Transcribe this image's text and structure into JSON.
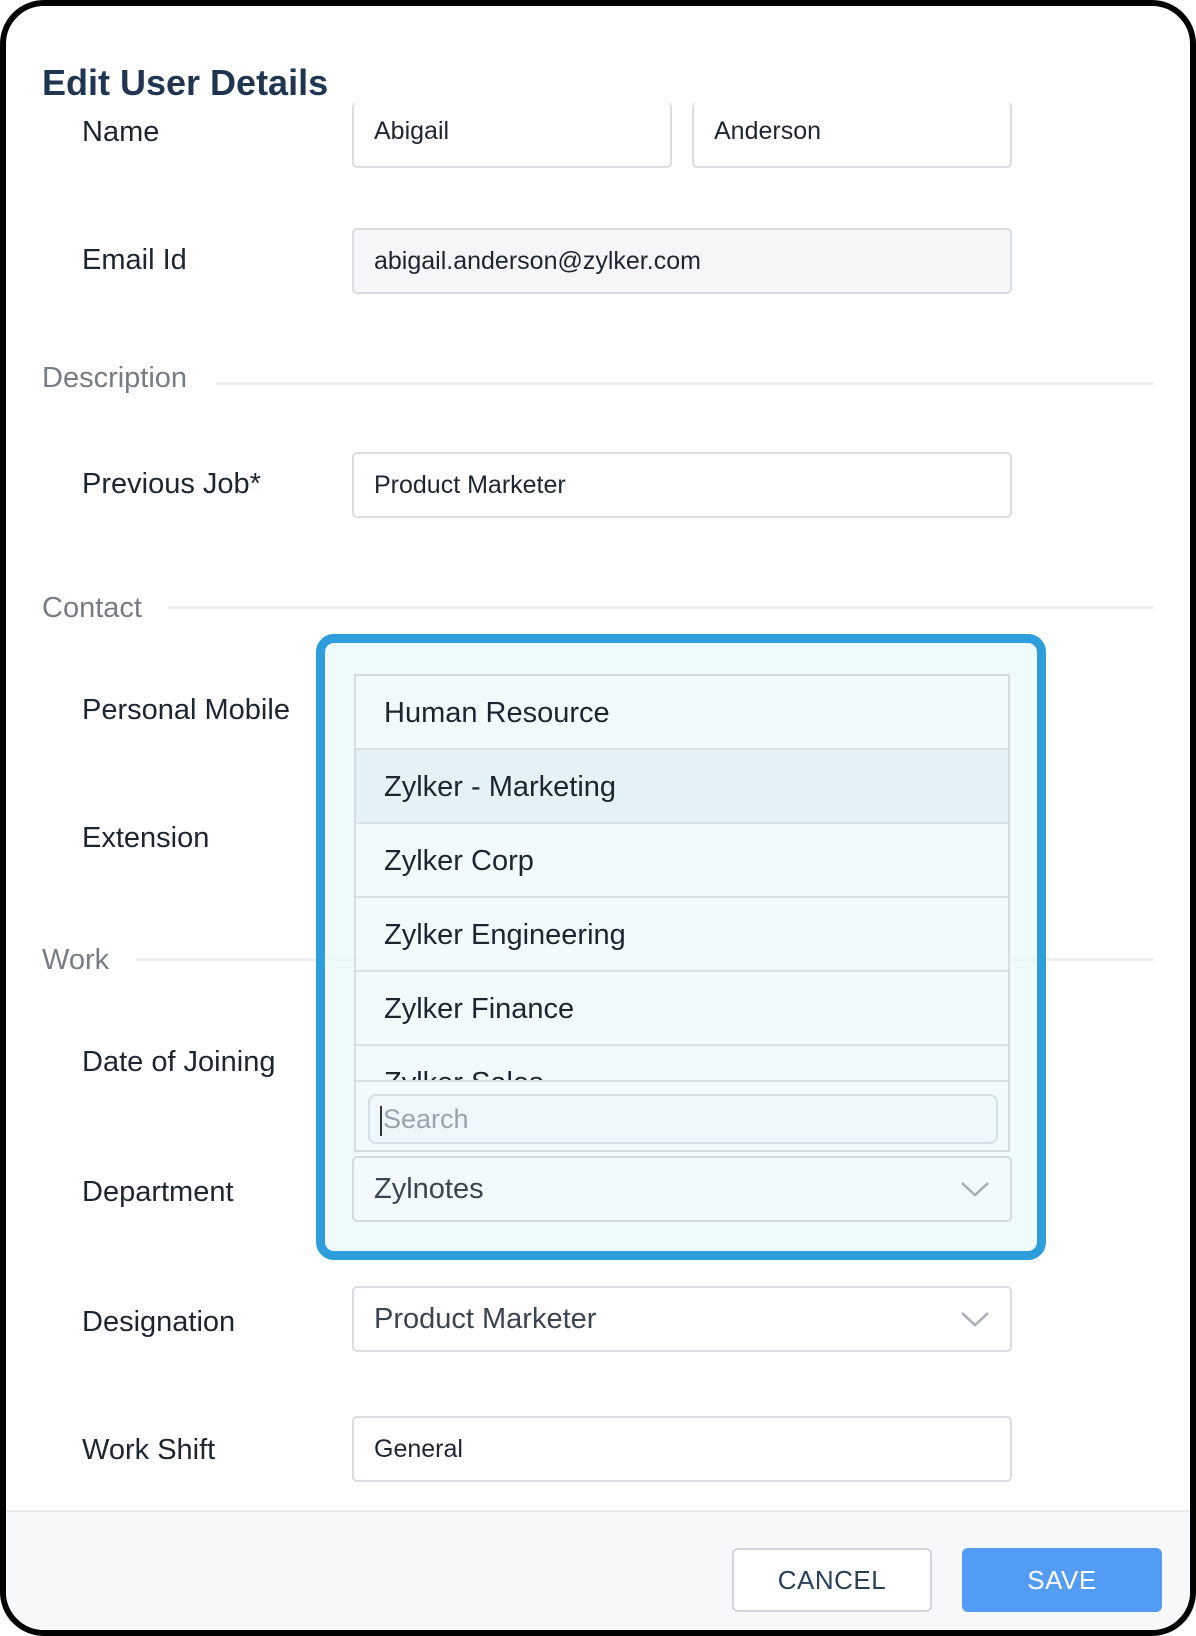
{
  "modal": {
    "title": "Edit User Details"
  },
  "fields": {
    "name": {
      "label": "Name",
      "first": "Abigail",
      "last": "Anderson"
    },
    "email": {
      "label": "Email Id",
      "value": "abigail.anderson@zylker.com"
    },
    "previous_job": {
      "label": "Previous Job*",
      "value": "Product Marketer"
    },
    "personal_mobile": {
      "label": "Personal Mobile"
    },
    "extension": {
      "label": "Extension"
    },
    "date_of_joining": {
      "label": "Date of Joining"
    },
    "department": {
      "label": "Department",
      "value": "Zylnotes"
    },
    "designation": {
      "label": "Designation",
      "value": "Product Marketer"
    },
    "work_shift": {
      "label": "Work Shift",
      "value": "General"
    }
  },
  "sections": {
    "description": "Description",
    "contact": "Contact",
    "work": "Work"
  },
  "dropdown": {
    "items": [
      "Human Resource",
      "Zylker - Marketing",
      "Zylker Corp",
      "Zylker Engineering",
      "Zylker Finance",
      "Zylker Sales"
    ],
    "hovered_index": 1,
    "search_placeholder": "Search"
  },
  "footer": {
    "cancel_label": "CANCEL",
    "save_label": "SAVE"
  },
  "colors": {
    "accent": "#2d9ddb",
    "save": "#539cf5",
    "title": "#1f3550"
  }
}
